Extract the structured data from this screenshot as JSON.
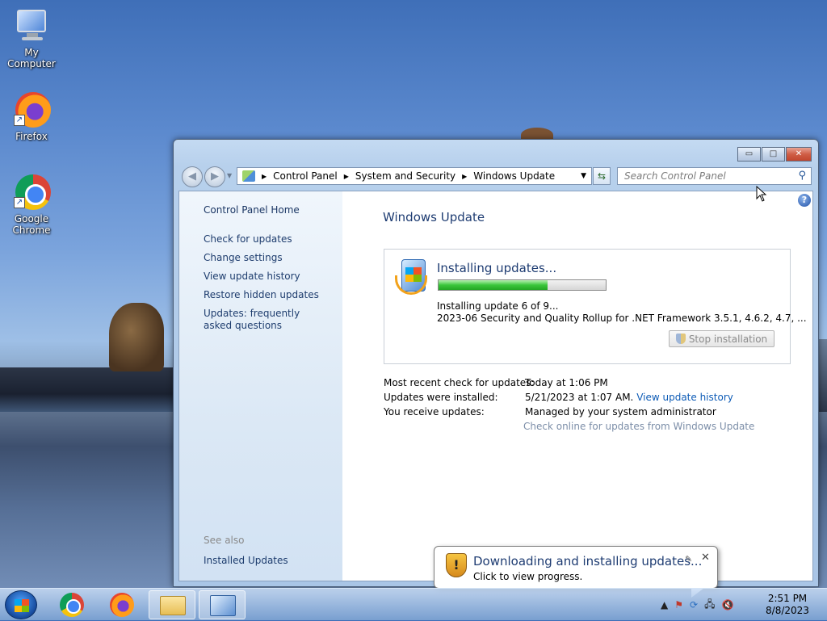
{
  "desktop": {
    "icons": [
      {
        "label": "My Computer",
        "icon": "computer-icon"
      },
      {
        "label": "Firefox",
        "icon": "firefox-icon"
      },
      {
        "label": "Google Chrome",
        "icon": "chrome-icon"
      }
    ]
  },
  "window": {
    "controls": {
      "minimize": "▭",
      "maximize": "□",
      "close": "✕"
    },
    "address": {
      "crumbs": [
        "Control Panel",
        "System and Security",
        "Windows Update"
      ]
    },
    "search": {
      "placeholder": "Search Control Panel"
    },
    "help": "?",
    "sidebar": {
      "home": "Control Panel Home",
      "links": [
        "Check for updates",
        "Change settings",
        "View update history",
        "Restore hidden updates",
        "Updates: frequently asked questions"
      ],
      "see_also": "See also",
      "see_also_links": [
        "Installed Updates"
      ]
    },
    "main": {
      "title": "Windows Update",
      "status": {
        "title": "Installing updates...",
        "progress_fraction": 0.65,
        "line1": "Installing update 6 of 9...",
        "line2": "2023-06 Security and Quality Rollup for .NET Framework 3.5.1, 4.6.2, 4.7, ...",
        "stop_button": "Stop installation"
      },
      "info": {
        "recent_check_label": "Most recent check for updates:",
        "recent_check_value": "Today at 1:06 PM",
        "installed_label": "Updates were installed:",
        "installed_value": "5/21/2023 at 1:07 AM.",
        "installed_link": "View update history",
        "receive_label": "You receive updates:",
        "receive_value": "Managed by your system administrator",
        "check_online": "Check online for updates from Windows Update"
      }
    }
  },
  "balloon": {
    "title": "Downloading and installing updates...",
    "subtitle": "Click to view progress."
  },
  "taskbar": {
    "time": "2:51 PM",
    "date": "8/8/2023"
  }
}
